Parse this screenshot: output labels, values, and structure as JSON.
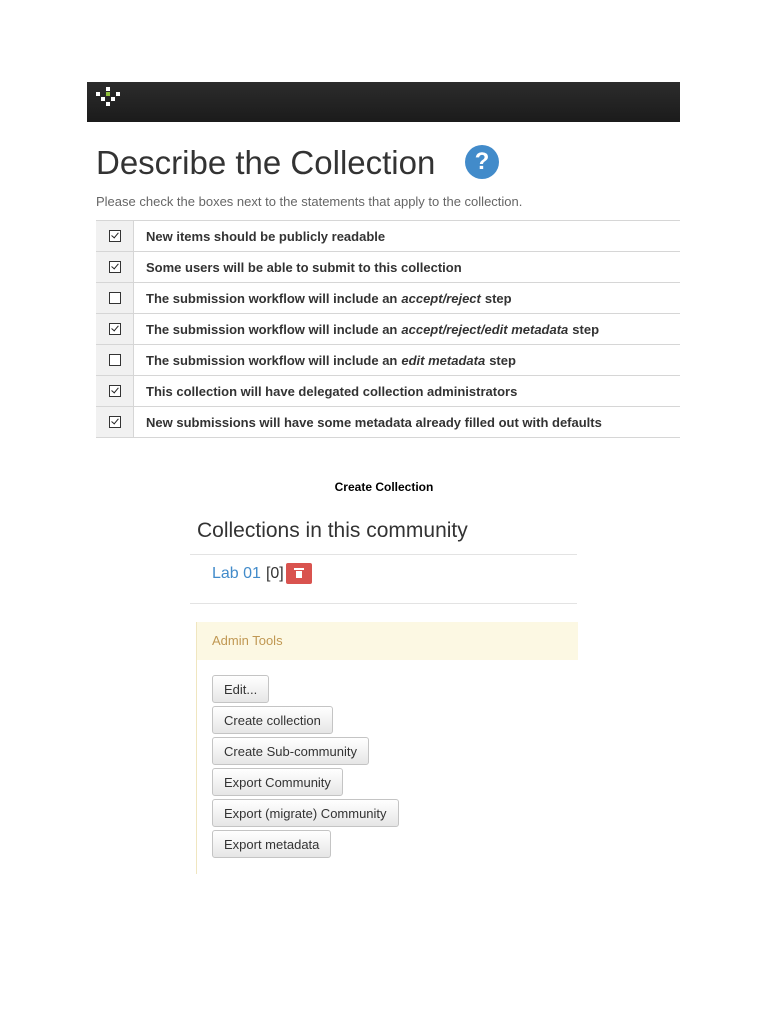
{
  "describe": {
    "title": "Describe the Collection",
    "help_glyph": "?",
    "instructions": "Please check the boxes next to the statements that apply to the collection.",
    "statements": [
      {
        "checked": true,
        "pre": "New items should be publicly readable",
        "em": "",
        "post": ""
      },
      {
        "checked": true,
        "pre": "Some users will be able to submit to this collection",
        "em": "",
        "post": ""
      },
      {
        "checked": false,
        "pre": "The submission workflow will include an",
        "em": "accept/reject",
        "post": "step"
      },
      {
        "checked": true,
        "pre": "The submission workflow will include an",
        "em": "accept/reject/edit metadata",
        "post": "step"
      },
      {
        "checked": false,
        "pre": "The submission workflow will include an",
        "em": "edit metadata",
        "post": "step"
      },
      {
        "checked": true,
        "pre": "This collection will have delegated collection administrators",
        "em": "",
        "post": ""
      },
      {
        "checked": true,
        "pre": "New submissions will have some metadata already filled out with defaults",
        "em": "",
        "post": ""
      }
    ]
  },
  "caption": "Create Collection",
  "community": {
    "heading": "Collections in this community",
    "collection": {
      "name": "Lab 01",
      "count": "[0]"
    },
    "delete_icon": "trash-icon"
  },
  "admin_tools": {
    "title": "Admin Tools",
    "buttons": [
      "Edit...",
      "Create collection",
      "Create Sub-community",
      "Export Community",
      "Export (migrate) Community",
      "Export metadata"
    ]
  },
  "colors": {
    "topbar": "#1f1f1f",
    "help": "#428bca",
    "link": "#428bca",
    "delete": "#d9534f",
    "admin_bg": "#fcf8e3",
    "admin_text": "#c09853"
  }
}
